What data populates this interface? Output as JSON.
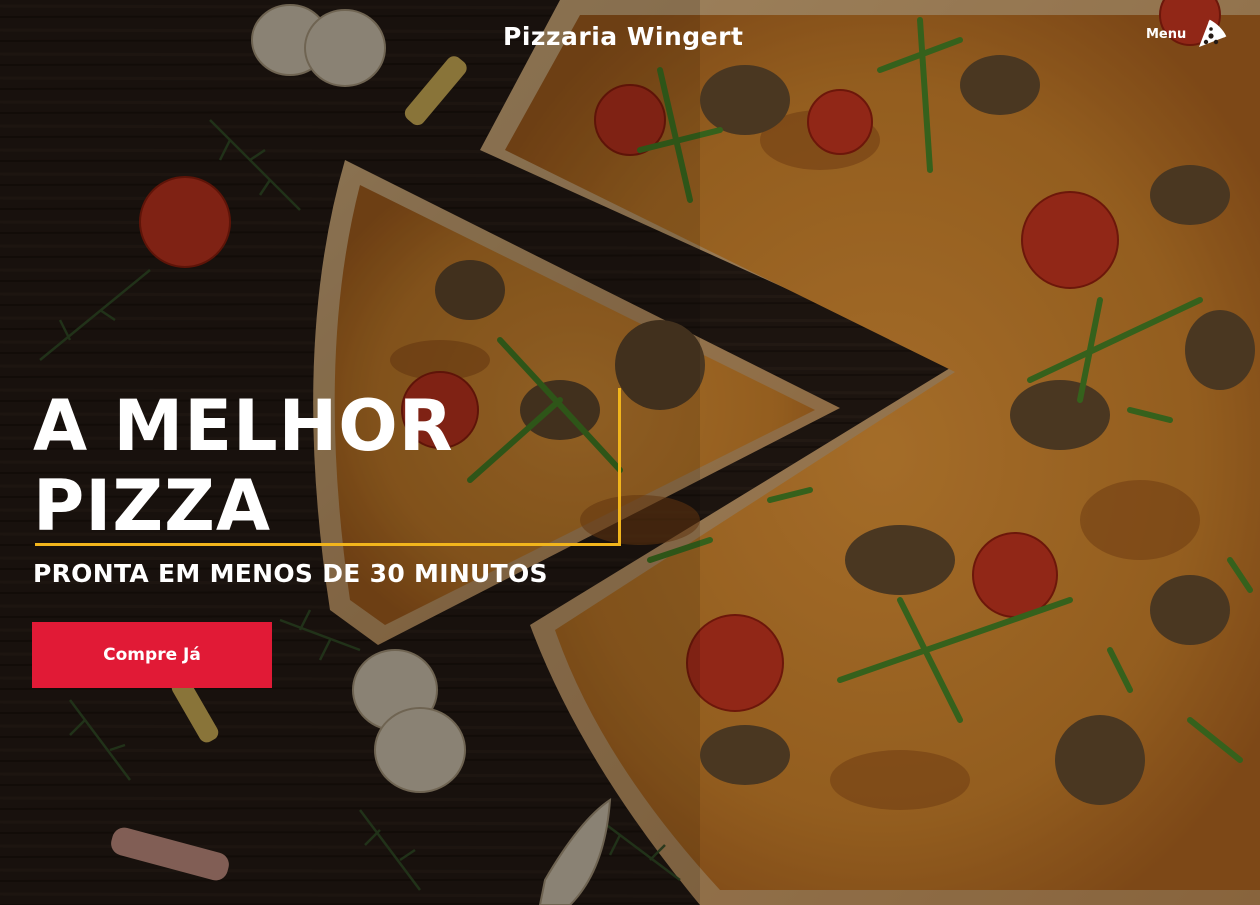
{
  "header": {
    "brand": "Pizzaria Wingert",
    "menu_label": "Menu",
    "menu_icon": "pizza-slice-icon"
  },
  "hero": {
    "headline_line1": "A MELHOR",
    "headline_line2": "PIZZA",
    "subtitle": "PRONTA EM MENOS DE 30 MINUTOS",
    "cta_label": "Compre Já",
    "background": "pizza-photo"
  },
  "colors": {
    "accent": "#f2b51c",
    "cta": "#e11a36",
    "text": "#ffffff"
  }
}
